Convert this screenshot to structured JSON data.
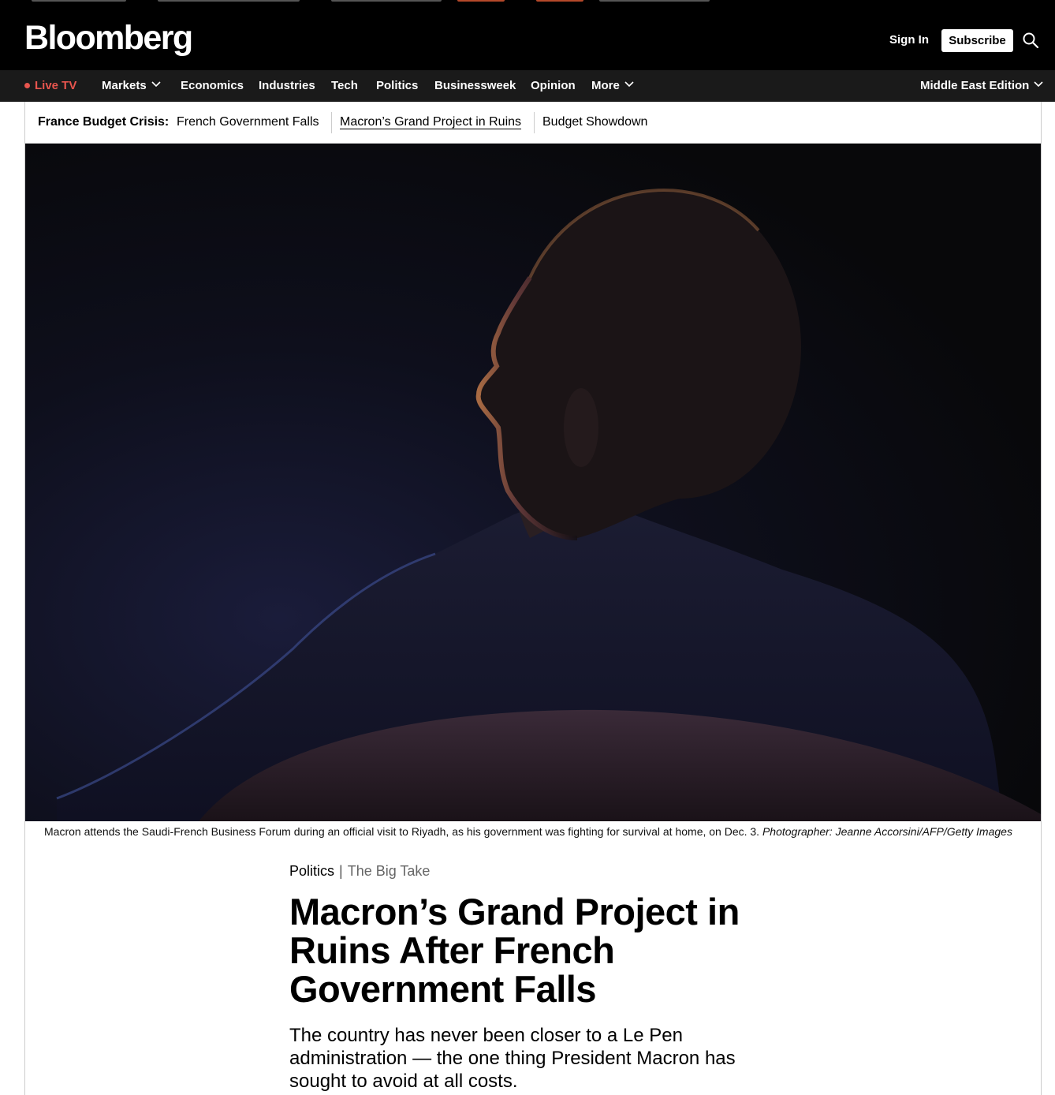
{
  "header": {
    "logo": "Bloomberg",
    "sign_in": "Sign In",
    "subscribe": "Subscribe"
  },
  "nav": {
    "live": "Live TV",
    "markets": "Markets",
    "economics": "Economics",
    "industries": "Industries",
    "tech": "Tech",
    "politics": "Politics",
    "businessweek": "Businessweek",
    "opinion": "Opinion",
    "more": "More",
    "edition": "Middle East Edition"
  },
  "rail": {
    "label": "France Budget Crisis:",
    "links": [
      "French Government Falls",
      "Macron’s Grand Project in Ruins",
      "Budget Showdown"
    ]
  },
  "caption": {
    "text": "Macron attends the Saudi-French Business Forum during an official visit to Riyadh, as his government was fighting for survival at home, on Dec. 3. ",
    "credit": "Photographer: Jeanne Accorsini/AFP/Getty Images"
  },
  "article": {
    "section": "Politics",
    "subsection": "The Big Take",
    "headline": "Macron’s Grand Project in Ruins After French Government Falls",
    "dek": "The country has never been closer to a Le Pen administration — the one thing President Macron has sought to avoid at all costs."
  },
  "colors": {
    "live_red": "#e8554e",
    "nav_bg": "#1a1a1a",
    "header_bg": "#000000"
  }
}
